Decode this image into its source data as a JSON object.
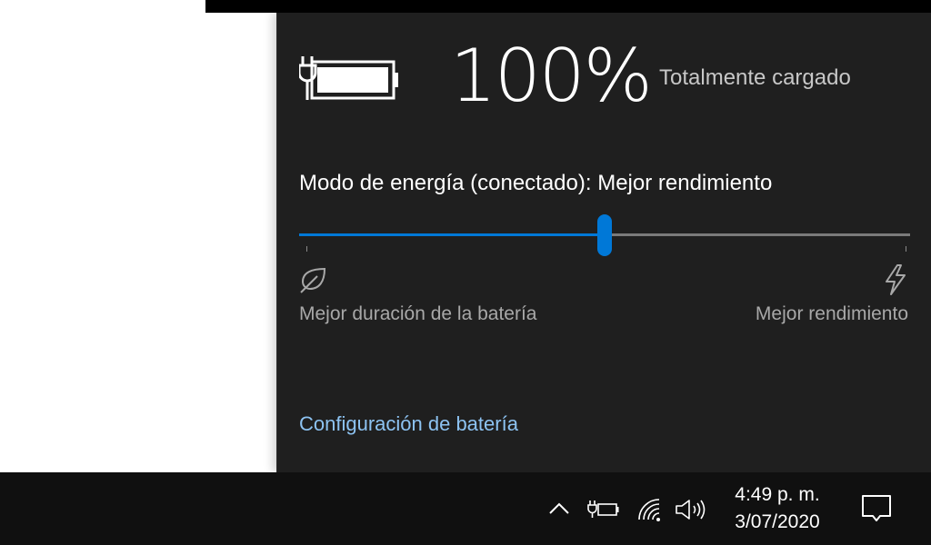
{
  "battery": {
    "percent_text": "100%",
    "level": 1.0,
    "status": "Totalmente cargado",
    "icon": "battery-charging-icon"
  },
  "power_mode": {
    "label": "Modo de energía (conectado): Mejor rendimiento",
    "slider_value_fraction": 0.5,
    "left_label": "Mejor duración de la batería",
    "right_label": "Mejor rendimiento",
    "left_icon": "leaf-icon",
    "right_icon": "lightning-bolt-icon"
  },
  "links": {
    "battery_settings": "Configuración de batería"
  },
  "taskbar": {
    "time": "4:49 p. m.",
    "date": "3/07/2020",
    "icons": [
      "chevron-up-icon",
      "battery-plug-icon",
      "wifi-icon",
      "volume-icon",
      "notifications-icon"
    ]
  },
  "colors": {
    "accent": "#0078d7",
    "flyout_bg": "#1f1f1f",
    "taskbar_bg": "#101010",
    "link": "#8dc3f2"
  }
}
